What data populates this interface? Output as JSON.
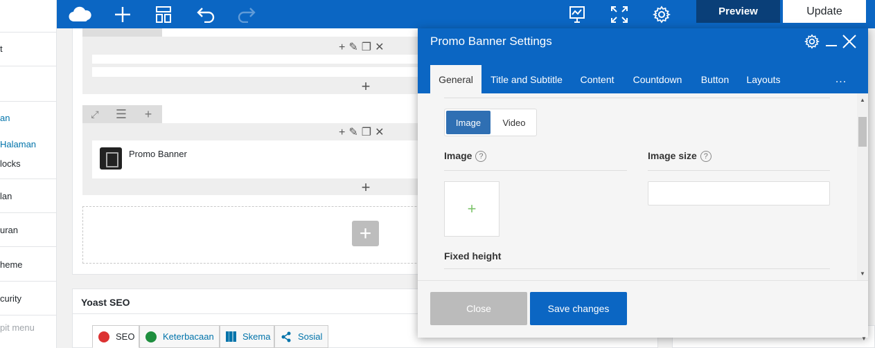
{
  "wp_menu": {
    "items": [
      {
        "label": "t"
      },
      {
        "label": "an"
      },
      {
        "label": "Halaman"
      },
      {
        "label": "locks"
      },
      {
        "label": "lan"
      },
      {
        "label": "uran"
      },
      {
        "label": "heme"
      },
      {
        "label": "curity"
      },
      {
        "label": "pit menu"
      }
    ]
  },
  "toolbar": {
    "preview_label": "Preview",
    "update_label": "Update"
  },
  "builder": {
    "module_name": "Promo Banner"
  },
  "yoast": {
    "title": "Yoast SEO",
    "tabs": [
      {
        "label": "SEO"
      },
      {
        "label": "Keterbacaan"
      },
      {
        "label": "Skema"
      },
      {
        "label": "Sosial"
      }
    ]
  },
  "modal": {
    "title": "Promo Banner Settings",
    "tabs": [
      {
        "label": "General"
      },
      {
        "label": "Title and Subtitle"
      },
      {
        "label": "Content"
      },
      {
        "label": "Countdown"
      },
      {
        "label": "Button"
      },
      {
        "label": "Layouts"
      },
      {
        "label": "..."
      }
    ],
    "media_type": {
      "image": "Image",
      "video": "Video",
      "selected": "Image"
    },
    "fields": {
      "image_label": "Image",
      "image_size_label": "Image size",
      "fixed_height_label": "Fixed height",
      "help": "?"
    },
    "close_label": "Close",
    "save_label": "Save changes"
  },
  "colors": {
    "brand": "#0b66c3",
    "preview_bg": "#0a3f78",
    "link": "#0073aa"
  }
}
